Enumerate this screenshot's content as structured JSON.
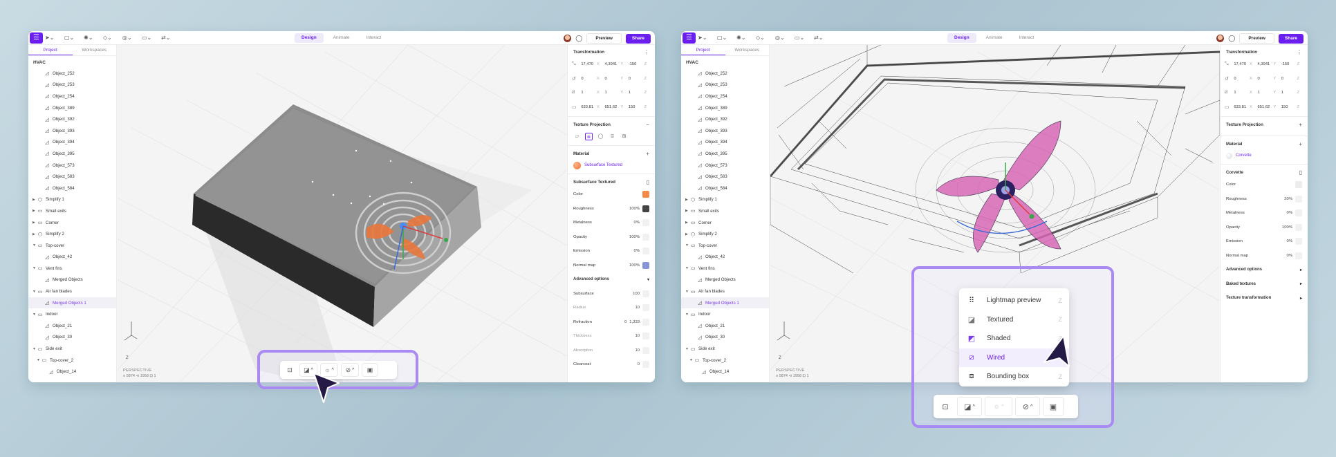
{
  "colors": {
    "accent": "#6a1ff0",
    "highlight": "#a88af2",
    "cursor": "#241a45"
  },
  "windows": [
    {
      "topbar": {
        "modes": [
          "Design",
          "Animate",
          "Interact"
        ],
        "preview_label": "Preview",
        "share_label": "Share"
      },
      "left_panel": {
        "tabs": [
          "Project",
          "Workspaces"
        ],
        "title": "HVAC",
        "tree": [
          "Object_252",
          "Object_253",
          "Object_254",
          "Object_389",
          "Object_392",
          "Object_393",
          "Object_394",
          "Object_395",
          "Object_573",
          "Object_583",
          "Object_584",
          "Simplify 1",
          "Small exits",
          "Corner",
          "Simplify 2",
          "Top-cover",
          "Object_42",
          "Vent fins",
          "Merged Objects",
          "Air fan blades",
          "Merged Objects 1",
          "Indoor",
          "Object_21",
          "Object_30",
          "Side exit",
          "Top-cover_2",
          "Object_14"
        ]
      },
      "viewport": {
        "perspective_label": "PERSPECTIVE",
        "stats": "≡ 5874  ⊲ 1958  ⊡ 1",
        "axes": [
          "Z",
          "X",
          "Y"
        ]
      },
      "right_panel": {
        "transformation": "Transformation",
        "rows": [
          [
            "17,470",
            "X",
            "4,3941",
            "Y",
            "-150",
            "Z"
          ],
          [
            "0",
            "X",
            "0",
            "Y",
            "0",
            "Z"
          ],
          [
            "1",
            "X",
            "1",
            "Y",
            "1",
            "Z"
          ],
          [
            "633,81",
            "X",
            "651,62",
            "Y",
            "150",
            "Z"
          ]
        ],
        "texture_projection": "Texture Projection",
        "material": "Material",
        "material_name": "Subsurface Textured",
        "material_section": "Subsurface Textured",
        "props": [
          {
            "label": "Color",
            "value": ""
          },
          {
            "label": "Roughness",
            "value": "100%"
          },
          {
            "label": "Metalness",
            "value": "0%"
          },
          {
            "label": "Opacity",
            "value": "100%"
          },
          {
            "label": "Emission",
            "value": "0%"
          },
          {
            "label": "Normal map",
            "value": "100%"
          }
        ],
        "advanced": "Advanced options",
        "adv_props": [
          {
            "label": "Subsurface",
            "value": "100"
          },
          {
            "label": "Radius",
            "value": "10"
          },
          {
            "label": "Refraction",
            "value": "0",
            "value2": "1,333"
          },
          {
            "label": "Thickness",
            "value": "10"
          },
          {
            "label": "Absorption",
            "value": "10"
          },
          {
            "label": "Clearcoat",
            "value": "0"
          }
        ]
      }
    },
    {
      "topbar": {
        "modes": [
          "Design",
          "Animate",
          "Interact"
        ],
        "preview_label": "Preview",
        "share_label": "Share"
      },
      "left_panel": {
        "tabs": [
          "Project",
          "Workspaces"
        ],
        "title": "HVAC",
        "tree": [
          "Object_252",
          "Object_253",
          "Object_254",
          "Object_389",
          "Object_392",
          "Object_393",
          "Object_394",
          "Object_395",
          "Object_573",
          "Object_583",
          "Object_584",
          "Simplify 1",
          "Small exits",
          "Corner",
          "Simplify 2",
          "Top-cover",
          "Object_42",
          "Vent fins",
          "Merged Objects",
          "Air fan blades",
          "Merged Objects 1",
          "Indoor",
          "Object_21",
          "Object_30",
          "Side exit",
          "Top-cover_2",
          "Object_14"
        ]
      },
      "viewport": {
        "perspective_label": "PERSPECTIVE",
        "stats": "≡ 5874  ⊲ 1958  ⊡ 1",
        "axes": [
          "Z",
          "X",
          "Y"
        ]
      },
      "right_panel": {
        "transformation": "Transformation",
        "rows": [
          [
            "17,470",
            "X",
            "4,3941",
            "Y",
            "-150",
            "Z"
          ],
          [
            "0",
            "X",
            "0",
            "Y",
            "0",
            "Z"
          ],
          [
            "1",
            "X",
            "1",
            "Y",
            "1",
            "Z"
          ],
          [
            "633,81",
            "X",
            "651,62",
            "Y",
            "150",
            "Z"
          ]
        ],
        "texture_projection": "Texture Projection",
        "material": "Material",
        "material_name": "Corvette",
        "material_section": "Corvette",
        "props": [
          {
            "label": "Color",
            "value": ""
          },
          {
            "label": "Roughness",
            "value": "20%"
          },
          {
            "label": "Metalness",
            "value": "0%"
          },
          {
            "label": "Opacity",
            "value": "100%"
          },
          {
            "label": "Emission",
            "value": "0%"
          },
          {
            "label": "Normal map",
            "value": "0%"
          }
        ],
        "advanced": "Advanced options",
        "baked": "Baked textures",
        "texture_transformation": "Texture transformation"
      }
    }
  ],
  "render_menu": {
    "items": [
      {
        "label": "Lightmap preview",
        "key": "Z",
        "icon": "lightmap-icon"
      },
      {
        "label": "Textured",
        "key": "Z",
        "icon": "textured-icon"
      },
      {
        "label": "Shaded",
        "key": "Z",
        "icon": "shaded-icon"
      },
      {
        "label": "Wired",
        "key": "Z",
        "icon": "wired-icon"
      },
      {
        "label": "Bounding box",
        "key": "Z",
        "icon": "bounding-box-icon"
      }
    ],
    "active": "Wired"
  }
}
